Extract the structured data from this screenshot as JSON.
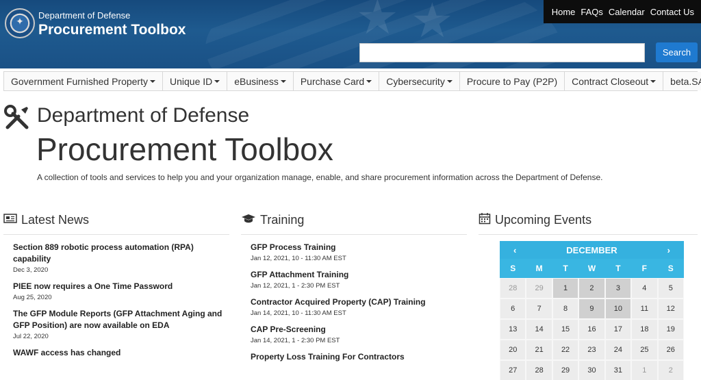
{
  "header": {
    "org_small": "Department of Defense",
    "org_large": "Procurement Toolbox",
    "top_links": [
      "Home",
      "FAQs",
      "Calendar",
      "Contact Us"
    ],
    "search_value": "",
    "search_button": "Search"
  },
  "menu": [
    {
      "label": "Government Furnished Property",
      "dropdown": true
    },
    {
      "label": "Unique ID",
      "dropdown": true
    },
    {
      "label": "eBusiness",
      "dropdown": true
    },
    {
      "label": "Purchase Card",
      "dropdown": true
    },
    {
      "label": "Cybersecurity",
      "dropdown": true
    },
    {
      "label": "Procure to Pay (P2P)",
      "dropdown": false
    },
    {
      "label": "Contract Closeout",
      "dropdown": true
    },
    {
      "label": "beta.SAM",
      "dropdown": true
    }
  ],
  "hero": {
    "subtitle": "Department of Defense",
    "title": "Procurement Toolbox",
    "description": "A collection of tools and services to help you and your organization manage, enable, and share procurement information across the Department of Defense."
  },
  "news": {
    "heading": "Latest News",
    "items": [
      {
        "title": "Section 889 robotic process automation (RPA) capability",
        "date": "Dec 3, 2020"
      },
      {
        "title": "PIEE now requires a One Time Password",
        "date": "Aug 25, 2020"
      },
      {
        "title": "The GFP Module Reports (GFP Attachment Aging and GFP Position) are now available on EDA",
        "date": "Jul 22, 2020"
      },
      {
        "title": "WAWF access has changed",
        "date": ""
      }
    ]
  },
  "training": {
    "heading": "Training",
    "items": [
      {
        "title": "GFP Process Training",
        "date": "Jan 12, 2021, 10 - 11:30 AM EST"
      },
      {
        "title": "GFP Attachment Training",
        "date": "Jan 12, 2021, 1 - 2:30 PM EST"
      },
      {
        "title": "Contractor Acquired Property (CAP) Training",
        "date": "Jan 14, 2021, 10 - 11:30 AM EST"
      },
      {
        "title": "CAP Pre-Screening",
        "date": "Jan 14, 2021, 1 - 2:30 PM EST"
      },
      {
        "title": "Property Loss Training For Contractors",
        "date": ""
      }
    ]
  },
  "events": {
    "heading": "Upcoming Events",
    "calendar": {
      "month": "DECEMBER",
      "prev": "‹",
      "next": "›",
      "weekdays": [
        "S",
        "M",
        "T",
        "W",
        "T",
        "F",
        "S"
      ],
      "weeks": [
        [
          {
            "d": "28",
            "m": true
          },
          {
            "d": "29",
            "m": true
          },
          {
            "d": "1",
            "e": true
          },
          {
            "d": "2",
            "e": true
          },
          {
            "d": "3",
            "e": true
          },
          {
            "d": "4"
          },
          {
            "d": "5"
          }
        ],
        [
          {
            "d": "6"
          },
          {
            "d": "7"
          },
          {
            "d": "8"
          },
          {
            "d": "9",
            "e": true
          },
          {
            "d": "10",
            "e": true
          },
          {
            "d": "11"
          },
          {
            "d": "12"
          }
        ],
        [
          {
            "d": "13"
          },
          {
            "d": "14"
          },
          {
            "d": "15"
          },
          {
            "d": "16"
          },
          {
            "d": "17"
          },
          {
            "d": "18"
          },
          {
            "d": "19"
          }
        ],
        [
          {
            "d": "20"
          },
          {
            "d": "21"
          },
          {
            "d": "22"
          },
          {
            "d": "23"
          },
          {
            "d": "24"
          },
          {
            "d": "25"
          },
          {
            "d": "26"
          }
        ],
        [
          {
            "d": "27"
          },
          {
            "d": "28"
          },
          {
            "d": "29"
          },
          {
            "d": "30"
          },
          {
            "d": "31"
          },
          {
            "d": "1",
            "m": true
          },
          {
            "d": "2",
            "m": true
          }
        ]
      ]
    }
  },
  "colors": {
    "banner": "#1a5186",
    "accent": "#1f7ad0",
    "calendar_header": "#35b1df"
  }
}
